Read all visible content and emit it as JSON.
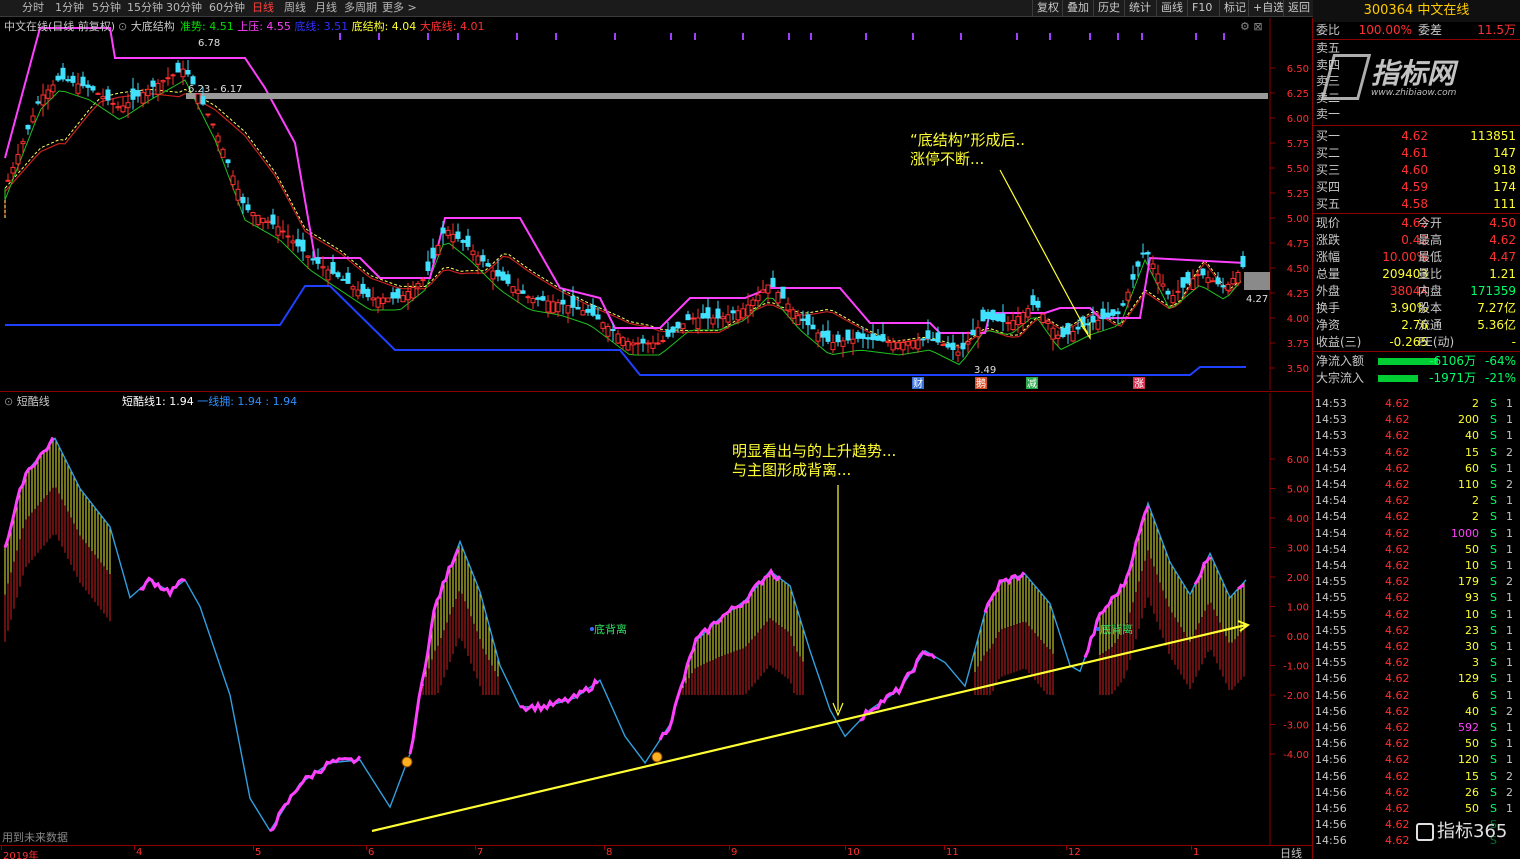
{
  "toolbar": {
    "tabs": [
      "分时",
      "1分钟",
      "5分钟",
      "15分钟",
      "30分钟",
      "60分钟",
      "日线",
      "周线",
      "月线",
      "多周期",
      "更多 >"
    ],
    "active_tab": "日线",
    "right_buttons": [
      "复权",
      "叠加",
      "历史",
      "统计",
      "画线",
      "F10",
      "标记",
      "+自选",
      "返回"
    ]
  },
  "stock_header": "300364 中文在线",
  "main_chart": {
    "title": "中文在线(日线 前复权)",
    "indicator_name": "大底结构",
    "legend": [
      {
        "label": "准势: 4.51",
        "color": "#00e000"
      },
      {
        "label": "上压: 4.55",
        "color": "#ff40ff"
      },
      {
        "label": "底线: 3.51",
        "color": "#3030ff"
      },
      {
        "label": "底结构: 4.04",
        "color": "#ffff33"
      },
      {
        "label": "大底线: 4.01",
        "color": "#ff3030"
      }
    ],
    "price_axis": [
      "6.50",
      "6.25",
      "6.00",
      "5.75",
      "5.50",
      "5.25",
      "5.00",
      "4.75",
      "4.50",
      "4.25",
      "4.00",
      "3.75",
      "3.50"
    ],
    "high_label": "6.78",
    "range_label": "6.23 - 6.17",
    "low_label": "3.49",
    "last_label": "4.27",
    "markers": [
      {
        "label": "财",
        "color": "#3a6fd8"
      },
      {
        "label": "鹅",
        "color": "#d8502a"
      },
      {
        "label": "减",
        "color": "#2aa84a"
      },
      {
        "label": "涨",
        "color": "#d83050"
      }
    ],
    "annotation": [
      "“底结构”形成后..",
      "涨停不断..."
    ]
  },
  "sub_chart": {
    "indicator_name": "短酷线",
    "legend": [
      {
        "label": "短酷线1: 1.94",
        "color": "#ffffff"
      },
      {
        "label": "一线拥: 1.94 : 1.94",
        "color": "#3090ff"
      }
    ],
    "axis": [
      "6.00",
      "5.00",
      "4.00",
      "3.00",
      "2.00",
      "1.00",
      "0.00",
      "-1.00",
      "-2.00",
      "-3.00",
      "-4.00"
    ],
    "divergence_labels": [
      "底背离",
      "底背离"
    ],
    "annotation": [
      "明显看出与的上升趋势...",
      "与主图形成背离..."
    ],
    "footer_note": "用到未来数据"
  },
  "x_axis": [
    "2019年",
    "4",
    "5",
    "6",
    "7",
    "8",
    "9",
    "10",
    "11",
    "12",
    "1"
  ],
  "x_axis_right": "日线",
  "quote_panel": {
    "weibi_label": "委比",
    "weibi": "100.00%",
    "weicha_label": "委差",
    "weicha": "11.5万",
    "sell": [
      {
        "label": "卖五"
      },
      {
        "label": "卖四"
      },
      {
        "label": "卖三"
      },
      {
        "label": "卖二"
      },
      {
        "label": "卖一"
      }
    ],
    "buy": [
      {
        "label": "买一",
        "price": "4.62",
        "vol": "113851"
      },
      {
        "label": "买二",
        "price": "4.61",
        "vol": "147"
      },
      {
        "label": "买三",
        "price": "4.60",
        "vol": "918"
      },
      {
        "label": "买四",
        "price": "4.59",
        "vol": "174"
      },
      {
        "label": "买五",
        "price": "4.58",
        "vol": "111"
      }
    ],
    "stats": [
      {
        "l1": "现价",
        "v1": "4.62",
        "l2": "今开",
        "v2": "4.50",
        "c1": "#ff3030",
        "c2": "#ff3030"
      },
      {
        "l1": "涨跌",
        "v1": "0.42",
        "l2": "最高",
        "v2": "4.62",
        "c1": "#ff3030",
        "c2": "#ff3030"
      },
      {
        "l1": "涨幅",
        "v1": "10.00%",
        "l2": "最低",
        "v2": "4.47",
        "c1": "#ff3030",
        "c2": "#ff3030"
      },
      {
        "l1": "总量",
        "v1": "209403",
        "l2": "量比",
        "v2": "1.21",
        "c1": "#ffff33",
        "c2": "#ffff33"
      },
      {
        "l1": "外盘",
        "v1": "38044",
        "l2": "内盘",
        "v2": "171359",
        "c1": "#ff3030",
        "c2": "#00ff66"
      },
      {
        "l1": "换手",
        "v1": "3.90%",
        "l2": "股本",
        "v2": "7.27亿",
        "c1": "#ffff33",
        "c2": "#ffff33"
      },
      {
        "l1": "净资",
        "v1": "2.76",
        "l2": "流通",
        "v2": "5.36亿",
        "c1": "#ffff33",
        "c2": "#ffff33"
      },
      {
        "l1": "收益(三)",
        "v1": "-0.265",
        "l2": "PE(动)",
        "v2": "-",
        "c1": "#ffff33",
        "c2": "#ffff33"
      }
    ],
    "netflow": {
      "label": "净流入额",
      "value": "-6106万",
      "pct": "-64%"
    },
    "bigflow": {
      "label": "大宗流入",
      "value": "-1971万",
      "pct": "-21%"
    },
    "watermark": "指标网",
    "watermark_url": "www.zhibiaow.com"
  },
  "ticks": [
    {
      "t": "14:53",
      "p": "4.62",
      "v": "2",
      "s": "S",
      "n": "1"
    },
    {
      "t": "14:53",
      "p": "4.62",
      "v": "200",
      "s": "S",
      "n": "1"
    },
    {
      "t": "14:53",
      "p": "4.62",
      "v": "40",
      "s": "S",
      "n": "1"
    },
    {
      "t": "14:53",
      "p": "4.62",
      "v": "15",
      "s": "S",
      "n": "2"
    },
    {
      "t": "14:54",
      "p": "4.62",
      "v": "60",
      "s": "S",
      "n": "1"
    },
    {
      "t": "14:54",
      "p": "4.62",
      "v": "110",
      "s": "S",
      "n": "2"
    },
    {
      "t": "14:54",
      "p": "4.62",
      "v": "2",
      "s": "S",
      "n": "1"
    },
    {
      "t": "14:54",
      "p": "4.62",
      "v": "2",
      "s": "S",
      "n": "1"
    },
    {
      "t": "14:54",
      "p": "4.62",
      "v": "1000",
      "s": "S",
      "n": "1",
      "pc": "#ff40ff"
    },
    {
      "t": "14:54",
      "p": "4.62",
      "v": "50",
      "s": "S",
      "n": "1"
    },
    {
      "t": "14:54",
      "p": "4.62",
      "v": "10",
      "s": "S",
      "n": "1"
    },
    {
      "t": "14:55",
      "p": "4.62",
      "v": "179",
      "s": "S",
      "n": "2"
    },
    {
      "t": "14:55",
      "p": "4.62",
      "v": "93",
      "s": "S",
      "n": "1"
    },
    {
      "t": "14:55",
      "p": "4.62",
      "v": "10",
      "s": "S",
      "n": "1"
    },
    {
      "t": "14:55",
      "p": "4.62",
      "v": "23",
      "s": "S",
      "n": "1"
    },
    {
      "t": "14:55",
      "p": "4.62",
      "v": "30",
      "s": "S",
      "n": "1"
    },
    {
      "t": "14:55",
      "p": "4.62",
      "v": "3",
      "s": "S",
      "n": "1"
    },
    {
      "t": "14:56",
      "p": "4.62",
      "v": "129",
      "s": "S",
      "n": "1"
    },
    {
      "t": "14:56",
      "p": "4.62",
      "v": "6",
      "s": "S",
      "n": "1"
    },
    {
      "t": "14:56",
      "p": "4.62",
      "v": "40",
      "s": "S",
      "n": "2"
    },
    {
      "t": "14:56",
      "p": "4.62",
      "v": "592",
      "s": "S",
      "n": "1",
      "pc": "#ff40ff"
    },
    {
      "t": "14:56",
      "p": "4.62",
      "v": "50",
      "s": "S",
      "n": "1"
    },
    {
      "t": "14:56",
      "p": "4.62",
      "v": "120",
      "s": "S",
      "n": "1"
    },
    {
      "t": "14:56",
      "p": "4.62",
      "v": "15",
      "s": "S",
      "n": "2"
    },
    {
      "t": "14:56",
      "p": "4.62",
      "v": "26",
      "s": "S",
      "n": "2"
    },
    {
      "t": "14:56",
      "p": "4.62",
      "v": "50",
      "s": "S",
      "n": "1"
    },
    {
      "t": "14:56",
      "p": "4.62",
      "v": "",
      "s": "S",
      "n": ""
    },
    {
      "t": "14:56",
      "p": "4.62",
      "v": "",
      "s": "S",
      "n": ""
    }
  ],
  "corner_logo": "指标365"
}
